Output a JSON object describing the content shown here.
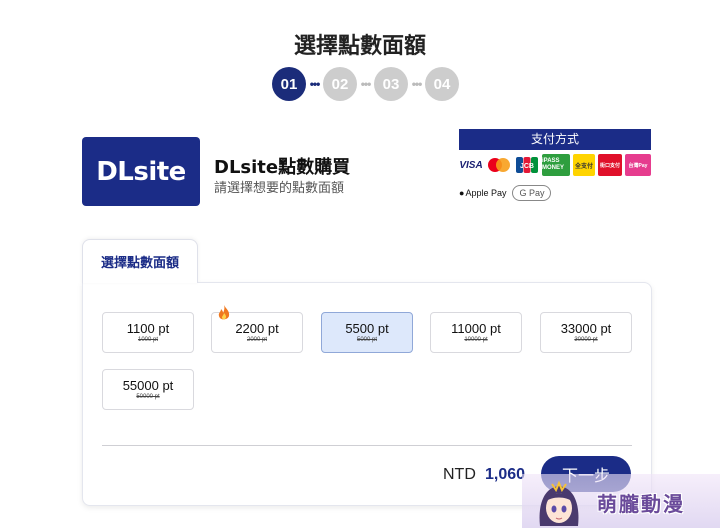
{
  "page": {
    "title": "選擇點數面額"
  },
  "steps": [
    "01",
    "02",
    "03",
    "04"
  ],
  "active_step": "01",
  "product": {
    "logo_text": "DLsite",
    "title": "DLsite點數購買",
    "subtitle": "請選擇想要的點數面額"
  },
  "payment": {
    "header": "支付方式",
    "methods_row1": [
      "VISA",
      "Mastercard",
      "JCB",
      "iPASS MONEY",
      "全支付",
      "街口支付",
      "台灣Pay"
    ],
    "methods_row2": [
      "Apple Pay",
      "G Pay"
    ]
  },
  "tab": {
    "label": "選擇點數面額"
  },
  "options": [
    {
      "label": "1100 pt",
      "original": "1000 pt",
      "selected": false,
      "hot": false
    },
    {
      "label": "2200 pt",
      "original": "2000 pt",
      "selected": false,
      "hot": true
    },
    {
      "label": "5500 pt",
      "original": "5000 pt",
      "selected": true,
      "hot": false
    },
    {
      "label": "11000 pt",
      "original": "10000 pt",
      "selected": false,
      "hot": false
    },
    {
      "label": "33000 pt",
      "original": "30000 pt",
      "selected": false,
      "hot": false
    },
    {
      "label": "55000 pt",
      "original": "50000 pt",
      "selected": false,
      "hot": false
    }
  ],
  "total": {
    "currency": "NTD",
    "amount": "1,060"
  },
  "next_button": {
    "label": "下一步"
  },
  "watermark": {
    "text": "萌朧動漫"
  },
  "colors": {
    "brand": "#1b2c87",
    "selected_bg": "#dde8fb",
    "step_inactive": "#cdcdcd"
  }
}
